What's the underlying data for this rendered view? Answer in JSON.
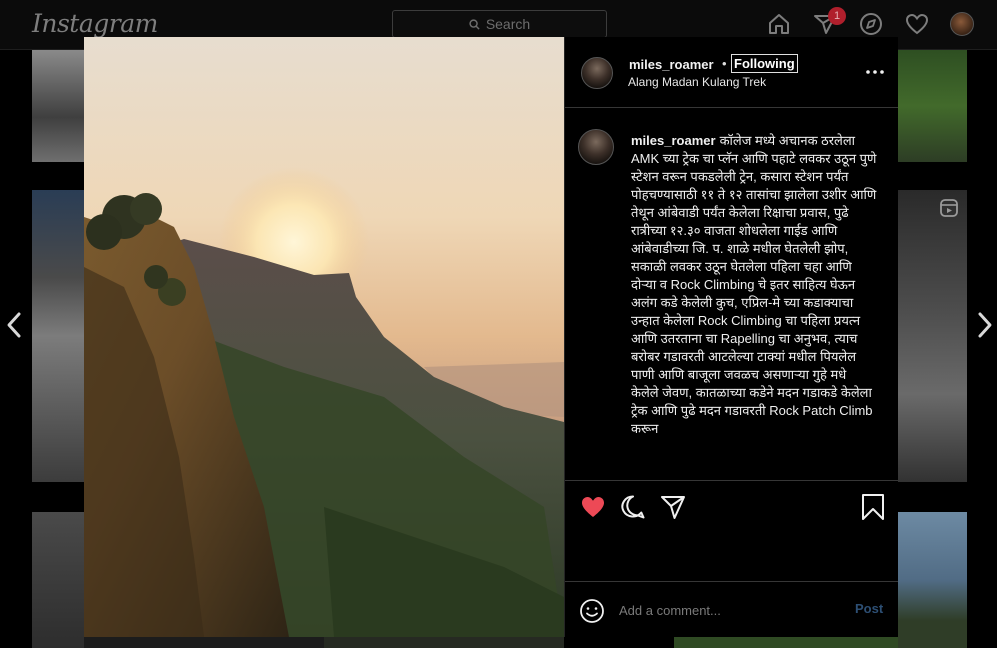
{
  "nav": {
    "logo": "Instagram",
    "search_placeholder": "Search",
    "notification_count": "1",
    "icons": [
      "home-icon",
      "direct-icon",
      "explore-icon",
      "heart-icon",
      "profile-avatar"
    ]
  },
  "post": {
    "username": "miles_roamer",
    "separator": "•",
    "follow_status": "Following",
    "location": "Alang Madan Kulang Trek",
    "caption_username": "miles_roamer",
    "caption_text": "कॉलेज मध्ये अचानक ठरलेला AMK च्या ट्रेक चा प्लॅन आणि पहाटे लवकर उठून पुणे स्टेशन वरून पकडलेली ट्रेन, कसारा स्टेशन पर्यंत पोहचण्यासाठी ११ ते १२ तासांचा झालेला उशीर आणि तेथून आंबेवाडी पर्यंत केलेला रिक्षाचा प्रवास, पुढे रात्रीच्या १२.३० वाजता शोधलेला गाईड आणि आंबेवाडीच्या जि. प. शाळे मधील घेतलेली झोप, सकाळी लवकर उठून घेतलेला पहिला चहा आणि दोऱ्या व Rock Climbing चे इतर साहित्य घेऊन अलंग कडे केलेली कुच, एप्रिल-मे च्या कडाक्याचा उन्हात केलेला Rock Climbing चा पहिला प्रयत्न आणि उतरताना चा Rapelling चा अनुभव, त्याच बरोबर गडावरती आटलेल्या टाक्यां मधील पियलेल पाणी आणि बाजूला जवळच असणाऱ्या गुहे मधे केलेले जेवण, कातळाच्या कडेने मदन गडाकडे केलेला ट्रेक आणि पुढे मदन गडावरती Rock Patch Climb करून",
    "liked": true,
    "like_color": "#ed4956",
    "comment_placeholder": "Add a comment...",
    "post_label": "Post"
  },
  "colors": {
    "background": "#000000",
    "post_button_disabled": "#2d4f74",
    "divider": "#363636"
  }
}
